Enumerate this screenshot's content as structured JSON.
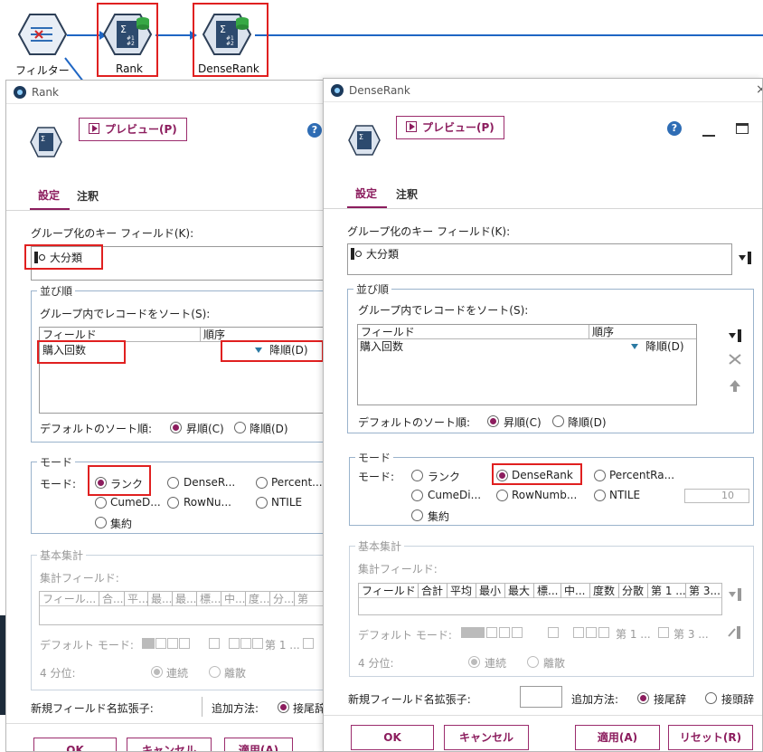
{
  "canvas": {
    "nodes": [
      {
        "label": "フィルター"
      },
      {
        "label": "Rank"
      },
      {
        "label": "DenseRank"
      }
    ]
  },
  "rank_dialog": {
    "title": "Rank",
    "preview_label": "プレビュー(P)",
    "tabs": [
      "設定",
      "注釈"
    ],
    "group_key_label": "グループ化のキー フィールド(K):",
    "group_key_value": "大分類",
    "sort_group_title": "並び順",
    "sort_label": "グループ内でレコードをソート(S):",
    "sort_columns": [
      "フィールド",
      "順序"
    ],
    "sort_row": {
      "field": "購入回数",
      "order": "降順(D)"
    },
    "default_sort_label": "デフォルトのソート順:",
    "asc_label": "昇順(C)",
    "desc_label": "降順(D)",
    "mode_group_title": "モード",
    "mode_label": "モード:",
    "modes": [
      "ランク",
      "DenseR...",
      "Percent...",
      "CumeD...",
      "RowNu...",
      "NTILE",
      "集約"
    ],
    "agg_group_title": "基本集計",
    "agg_field_label": "集計フィールド:",
    "agg_columns": [
      "フィール...",
      "合...",
      "平...",
      "最...",
      "最...",
      "標...",
      "中...",
      "度...",
      "分...",
      "第"
    ],
    "default_mode_label": "デフォルト モード:",
    "default_mode_extra": "第 1 ...",
    "quartile_label": "4 分位:",
    "quartile_opts": [
      "連続",
      "離散"
    ],
    "new_field_label": "新規フィールド名拡張子:",
    "add_method_label": "追加方法:",
    "suffix_label": "接尾辞",
    "buttons": [
      "OK",
      "キャンセル",
      "適用(A)"
    ]
  },
  "dense_dialog": {
    "title": "DenseRank",
    "preview_label": "プレビュー(P)",
    "tabs": [
      "設定",
      "注釈"
    ],
    "group_key_label": "グループ化のキー フィールド(K):",
    "group_key_value": "大分類",
    "sort_group_title": "並び順",
    "sort_label": "グループ内でレコードをソート(S):",
    "sort_columns": [
      "フィールド",
      "順序"
    ],
    "sort_row": {
      "field": "購入回数",
      "order": "降順(D)"
    },
    "default_sort_label": "デフォルトのソート順:",
    "asc_label": "昇順(C)",
    "desc_label": "降順(D)",
    "mode_group_title": "モード",
    "mode_label": "モード:",
    "modes": [
      "ランク",
      "DenseRank",
      "PercentRa...",
      "CumeDi...",
      "RowNumb...",
      "NTILE",
      "集約"
    ],
    "ntile_value": "10",
    "agg_group_title": "基本集計",
    "agg_field_label": "集計フィールド:",
    "agg_columns": [
      "フィールド",
      "合計",
      "平均",
      "最小",
      "最大",
      "標...",
      "中...",
      "度数",
      "分散",
      "第 1 ...",
      "第 3..."
    ],
    "default_mode_label": "デフォルト モード:",
    "default_mode_extra1": "第 1 ...",
    "default_mode_extra2": "第 3 ...",
    "quartile_label": "4 分位:",
    "quartile_opts": [
      "連続",
      "離散"
    ],
    "new_field_label": "新規フィールド名拡張子:",
    "add_method_label": "追加方法:",
    "suffix_label": "接尾辞",
    "prefix_label": "接頭辞",
    "buttons": [
      "OK",
      "キャンセル",
      "適用(A)",
      "リセット(R)"
    ]
  }
}
